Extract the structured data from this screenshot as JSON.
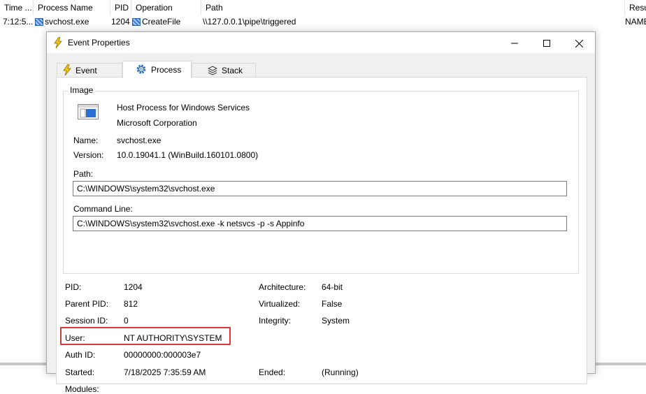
{
  "background_list": {
    "columns": [
      "Time ...",
      "Process Name",
      "PID",
      "Operation",
      "Path",
      "Resu"
    ],
    "row": {
      "time": "7:12:5...",
      "process": "svchost.exe",
      "pid": "1204",
      "operation": "CreateFile",
      "path": "\\\\127.0.0.1\\pipe\\triggered",
      "result": "NAME"
    }
  },
  "dialog": {
    "title": "Event Properties",
    "tabs": [
      {
        "label": "Event"
      },
      {
        "label": "Process"
      },
      {
        "label": "Stack"
      }
    ],
    "image": {
      "group_label": "Image",
      "description": "Host Process for Windows Services",
      "company": "Microsoft Corporation",
      "name_label": "Name:",
      "name_value": "svchost.exe",
      "version_label": "Version:",
      "version_value": "10.0.19041.1 (WinBuild.160101.0800)",
      "path_label": "Path:",
      "path_value": "C:\\WINDOWS\\system32\\svchost.exe",
      "cmdline_label": "Command Line:",
      "cmdline_value": "C:\\WINDOWS\\system32\\svchost.exe -k netsvcs -p -s Appinfo"
    },
    "details": {
      "pid_label": "PID:",
      "pid_value": "1204",
      "ppid_label": "Parent PID:",
      "ppid_value": "812",
      "session_label": "Session ID:",
      "session_value": "0",
      "user_label": "User:",
      "user_value": "NT AUTHORITY\\SYSTEM",
      "auth_label": "Auth ID:",
      "auth_value": "00000000:000003e7",
      "started_label": "Started:",
      "started_value": "7/18/2025 7:35:59 AM",
      "modules_label": "Modules:",
      "arch_label": "Architecture:",
      "arch_value": "64-bit",
      "virt_label": "Virtualized:",
      "virt_value": "False",
      "integrity_label": "Integrity:",
      "integrity_value": "System",
      "ended_label": "Ended:",
      "ended_value": "(Running)"
    }
  },
  "colors": {
    "highlight": "#d9383a",
    "accent": "#3a78d6"
  }
}
